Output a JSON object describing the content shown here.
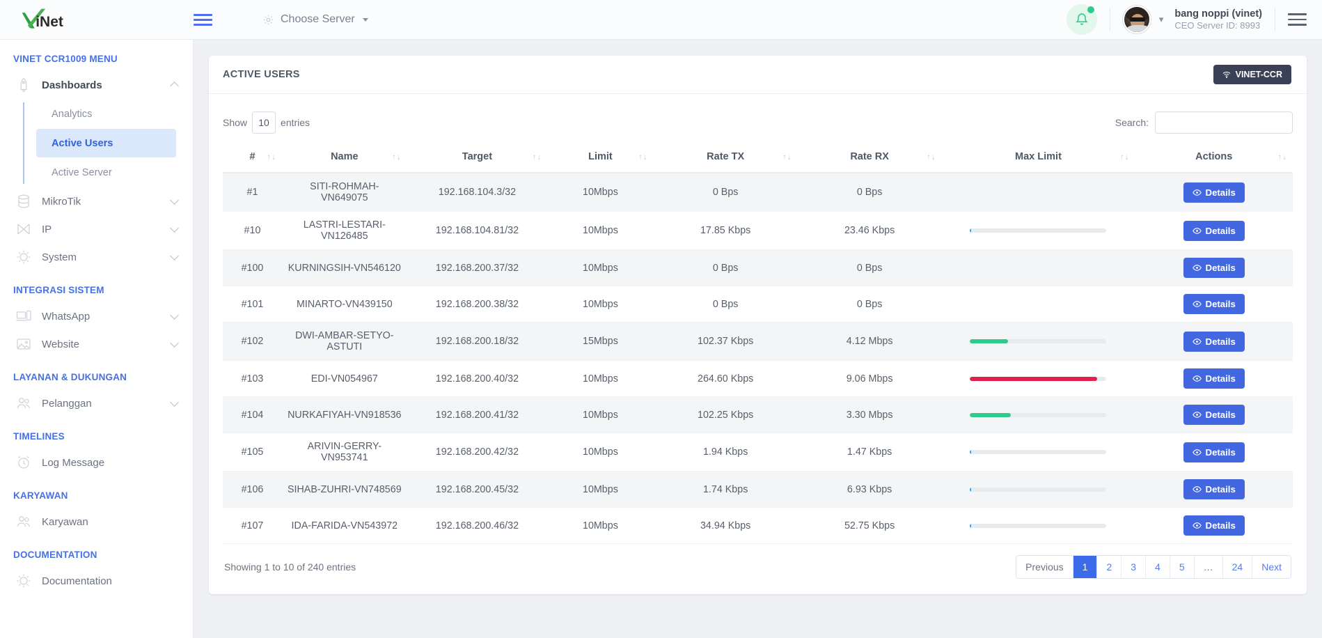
{
  "topbar": {
    "logo_text": "ViNet",
    "menu_toggle_icon": "hamburger-icon",
    "choose_server_label": "Choose Server",
    "choose_server_icon": "gear-icon",
    "notification_icon": "bell-icon",
    "user_name": "bang noppi (vinet)",
    "user_subtitle": "CEO Server ID: 8993",
    "right_menu_icon": "hamburger-icon"
  },
  "sidebar": {
    "sections": [
      {
        "title": "VINET CCR1009 MENU",
        "items": [
          {
            "label": "Dashboards",
            "icon": "rocket-icon",
            "type": "parent",
            "expanded": true,
            "children": [
              {
                "label": "Analytics",
                "active": false
              },
              {
                "label": "Active Users",
                "active": true
              },
              {
                "label": "Active Server",
                "active": false
              }
            ]
          },
          {
            "label": "MikroTik",
            "icon": "database-icon",
            "type": "parent",
            "expanded": false
          },
          {
            "label": "IP",
            "icon": "network-icon",
            "type": "parent",
            "expanded": false
          },
          {
            "label": "System",
            "icon": "settings-icon",
            "type": "parent",
            "expanded": false
          }
        ]
      },
      {
        "title": "INTEGRASI SISTEM",
        "items": [
          {
            "label": "WhatsApp",
            "icon": "devices-icon",
            "type": "parent",
            "expanded": false
          },
          {
            "label": "Website",
            "icon": "image-icon",
            "type": "parent",
            "expanded": false
          }
        ]
      },
      {
        "title": "LAYANAN & DUKUNGAN",
        "items": [
          {
            "label": "Pelanggan",
            "icon": "users-icon",
            "type": "parent",
            "expanded": false
          }
        ]
      },
      {
        "title": "TIMELINES",
        "items": [
          {
            "label": "Log Message",
            "icon": "alarm-clock-icon",
            "type": "link"
          }
        ]
      },
      {
        "title": "KARYAWAN",
        "items": [
          {
            "label": "Karyawan",
            "icon": "users-icon",
            "type": "link"
          }
        ]
      },
      {
        "title": "DOCUMENTATION",
        "items": [
          {
            "label": "Documentation",
            "icon": "settings-icon",
            "type": "link"
          }
        ]
      }
    ]
  },
  "card": {
    "title": "ACTIVE USERS",
    "badge_label": "VINET-CCR",
    "badge_icon": "wifi-icon"
  },
  "controls": {
    "show_label": "Show",
    "entries_label": "entries",
    "page_length": "10",
    "search_label": "Search:",
    "search_value": "",
    "search_placeholder": ""
  },
  "table": {
    "columns": [
      "#",
      "Name",
      "Target",
      "Limit",
      "Rate TX",
      "Rate RX",
      "Max Limit",
      "Actions"
    ],
    "sort_icon": "sort-updown-icon",
    "action_label": "Details",
    "action_icon": "eye-icon",
    "rows": [
      {
        "index": "#1",
        "name": "SITI-ROHMAH-VN649075",
        "target": "192.168.104.3/32",
        "limit": "10Mbps",
        "rate_tx": "0 Bps",
        "rate_rx": "0 Bps",
        "max_limit_percent": 0,
        "max_limit_color": ""
      },
      {
        "index": "#10",
        "name": "LASTRI-LESTARI-VN126485",
        "target": "192.168.104.81/32",
        "limit": "10Mbps",
        "rate_tx": "17.85 Kbps",
        "rate_rx": "23.46 Kbps",
        "max_limit_percent": 1,
        "max_limit_color": "#2aa3e8"
      },
      {
        "index": "#100",
        "name": "KURNINGSIH-VN546120",
        "target": "192.168.200.37/32",
        "limit": "10Mbps",
        "rate_tx": "0 Bps",
        "rate_rx": "0 Bps",
        "max_limit_percent": 0,
        "max_limit_color": ""
      },
      {
        "index": "#101",
        "name": "MINARTO-VN439150",
        "target": "192.168.200.38/32",
        "limit": "10Mbps",
        "rate_tx": "0 Bps",
        "rate_rx": "0 Bps",
        "max_limit_percent": 0,
        "max_limit_color": ""
      },
      {
        "index": "#102",
        "name": "DWI-AMBAR-SETYO-ASTUTI",
        "target": "192.168.200.18/32",
        "limit": "15Mbps",
        "rate_tx": "102.37 Kbps",
        "rate_rx": "4.12 Mbps",
        "max_limit_percent": 28,
        "max_limit_color": "#2ecc8a"
      },
      {
        "index": "#103",
        "name": "EDI-VN054967",
        "target": "192.168.200.40/32",
        "limit": "10Mbps",
        "rate_tx": "264.60 Kbps",
        "rate_rx": "9.06 Mbps",
        "max_limit_percent": 93,
        "max_limit_color": "#e0214f"
      },
      {
        "index": "#104",
        "name": "NURKAFIYAH-VN918536",
        "target": "192.168.200.41/32",
        "limit": "10Mbps",
        "rate_tx": "102.25 Kbps",
        "rate_rx": "3.30 Mbps",
        "max_limit_percent": 30,
        "max_limit_color": "#2ecc8a"
      },
      {
        "index": "#105",
        "name": "ARIVIN-GERRY-VN953741",
        "target": "192.168.200.42/32",
        "limit": "10Mbps",
        "rate_tx": "1.94 Kbps",
        "rate_rx": "1.47 Kbps",
        "max_limit_percent": 0.2,
        "max_limit_color": "#2aa3e8"
      },
      {
        "index": "#106",
        "name": "SIHAB-ZUHRI-VN748569",
        "target": "192.168.200.45/32",
        "limit": "10Mbps",
        "rate_tx": "1.74 Kbps",
        "rate_rx": "6.93 Kbps",
        "max_limit_percent": 1,
        "max_limit_color": "#2aa3e8"
      },
      {
        "index": "#107",
        "name": "IDA-FARIDA-VN543972",
        "target": "192.168.200.46/32",
        "limit": "10Mbps",
        "rate_tx": "34.94 Kbps",
        "rate_rx": "52.75 Kbps",
        "max_limit_percent": 1,
        "max_limit_color": "#2aa3e8"
      }
    ]
  },
  "footer": {
    "info": "Showing 1 to 10 of 240 entries",
    "pagination": [
      {
        "label": "Previous",
        "active": false,
        "muted": true
      },
      {
        "label": "1",
        "active": true,
        "muted": false
      },
      {
        "label": "2",
        "active": false,
        "muted": false
      },
      {
        "label": "3",
        "active": false,
        "muted": false
      },
      {
        "label": "4",
        "active": false,
        "muted": false
      },
      {
        "label": "5",
        "active": false,
        "muted": false
      },
      {
        "label": "…",
        "active": false,
        "muted": true
      },
      {
        "label": "24",
        "active": false,
        "muted": false
      },
      {
        "label": "Next",
        "active": false,
        "muted": false
      }
    ]
  },
  "colors": {
    "accent_blue": "#4267e0",
    "nav_heading_blue": "#4670e4",
    "active_bg": "#dbe7fb",
    "green": "#2ecc8a",
    "red": "#e0214f",
    "light_blue": "#2aa3e8",
    "badge_dark": "#3a4055"
  }
}
